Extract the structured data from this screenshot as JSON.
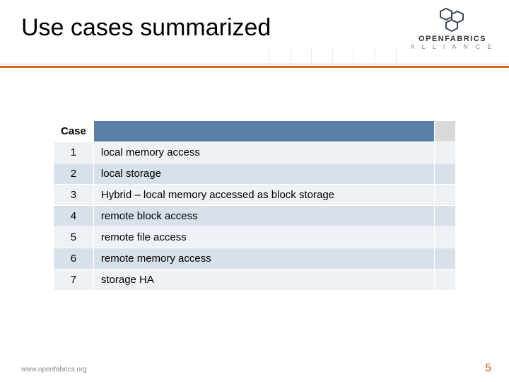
{
  "title": "Use cases summarized",
  "logo": {
    "line1": "OPENFABRICS",
    "line2": "A L L I A N C E"
  },
  "table": {
    "header": {
      "case": "Case"
    },
    "rows": [
      {
        "case": "1",
        "desc": "local memory access"
      },
      {
        "case": "2",
        "desc": "local storage"
      },
      {
        "case": "3",
        "desc": "Hybrid – local memory accessed as block storage"
      },
      {
        "case": "4",
        "desc": "remote block access"
      },
      {
        "case": "5",
        "desc": "remote file access"
      },
      {
        "case": "6",
        "desc": "remote memory access"
      },
      {
        "case": "7",
        "desc": "storage HA"
      }
    ]
  },
  "footer": {
    "url": "www.openfabrics.org",
    "page": "5"
  }
}
